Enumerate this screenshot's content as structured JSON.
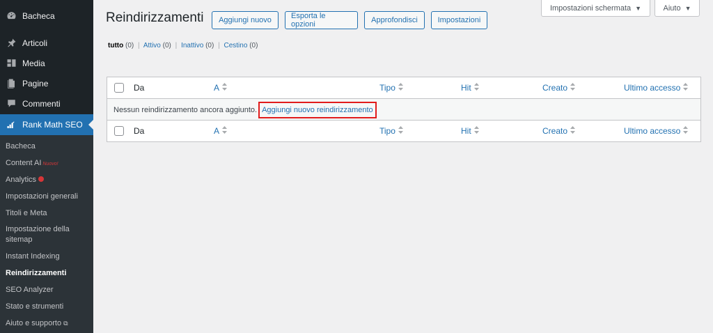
{
  "sidebar": {
    "menu": [
      {
        "label": "Bacheca",
        "icon": "dashboard-icon"
      },
      {
        "label": "Articoli",
        "icon": "pin-icon"
      },
      {
        "label": "Media",
        "icon": "media-icon"
      },
      {
        "label": "Pagine",
        "icon": "page-icon"
      },
      {
        "label": "Commenti",
        "icon": "comment-icon"
      },
      {
        "label": "Rank Math SEO",
        "icon": "rank-math-icon"
      }
    ],
    "submenu": [
      {
        "label": "Bacheca"
      },
      {
        "label": "Content AI",
        "badge": "Nuovo!"
      },
      {
        "label": "Analytics"
      },
      {
        "label": "Impostazioni generali"
      },
      {
        "label": "Titoli e Meta"
      },
      {
        "label": "Impostazione della sitemap"
      },
      {
        "label": "Instant Indexing"
      },
      {
        "label": "Reindirizzamenti"
      },
      {
        "label": "SEO Analyzer"
      },
      {
        "label": "Stato e strumenti"
      },
      {
        "label": "Aiuto e supporto"
      }
    ]
  },
  "screen_options": {
    "label": "Impostazioni schermata",
    "caret": "▼"
  },
  "help": {
    "label": "Aiuto",
    "caret": "▼"
  },
  "header": {
    "title": "Reindirizzamenti",
    "actions": [
      "Aggiungi nuovo",
      "Esporta le opzioni",
      "Approfondisci",
      "Impostazioni"
    ]
  },
  "views": [
    {
      "label": "tutto",
      "count": "(0)"
    },
    {
      "label": "Attivo",
      "count": "(0)"
    },
    {
      "label": "Inattivo",
      "count": "(0)"
    },
    {
      "label": "Cestino",
      "count": "(0)"
    }
  ],
  "views_separator": "|",
  "table": {
    "columns": [
      "Da",
      "A",
      "Tipo",
      "Hit",
      "Creato",
      "Ultimo accesso"
    ],
    "empty_message": "Nessun reindirizzamento ancora aggiunto.",
    "empty_link": "Aggiungi nuovo reindirizzamento"
  },
  "colors": {
    "sidebar_bg": "#1d2327",
    "submenu_bg": "#2c3338",
    "accent": "#2271b1",
    "highlight_box": "#e11b1b"
  }
}
